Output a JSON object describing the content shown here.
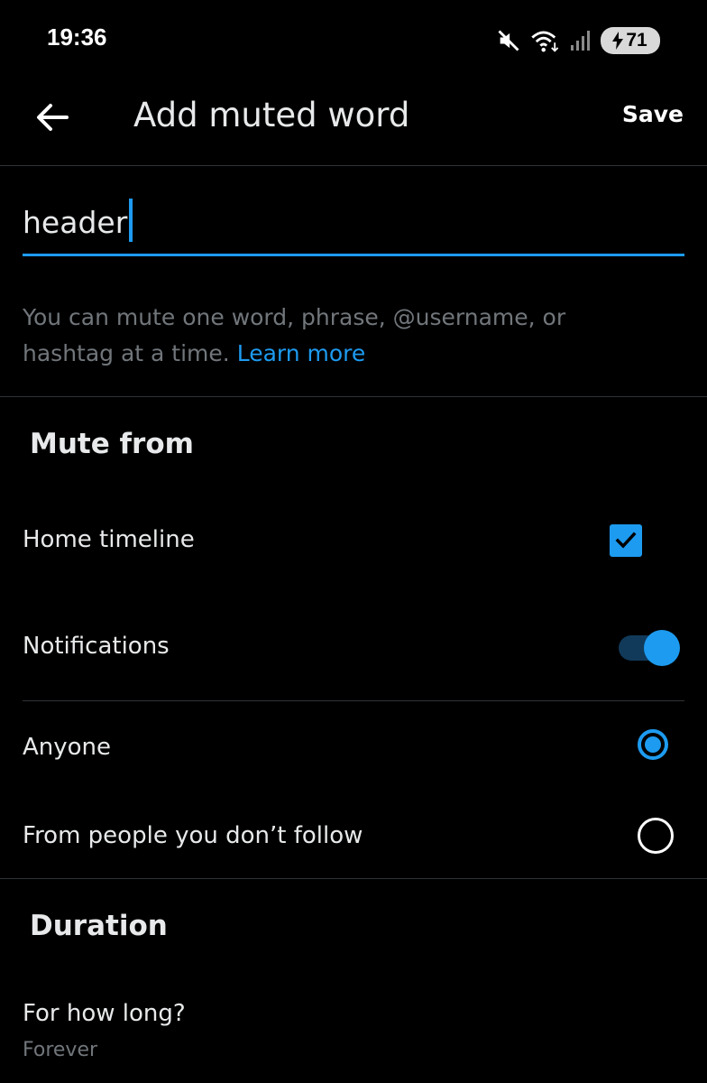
{
  "status_bar": {
    "time": "19:36",
    "battery": "71",
    "icons": [
      "mute-icon",
      "wifi-icon",
      "signal-icon",
      "charging-bolt-icon"
    ]
  },
  "header": {
    "title": "Add muted word",
    "save_label": "Save",
    "back_icon": "arrow-left-icon"
  },
  "input": {
    "value": "header"
  },
  "hint": {
    "text": "You can mute one word, phrase, @username, or hashtag at a time.",
    "link": "Learn more"
  },
  "mute_from": {
    "title": "Mute from",
    "home_timeline": {
      "label": "Home timeline",
      "checked": true
    },
    "notifications": {
      "label": "Notifications",
      "enabled": true
    }
  },
  "audience": {
    "anyone": {
      "label": "Anyone",
      "selected": true
    },
    "not_following": {
      "label": "From people you don’t follow",
      "selected": false
    }
  },
  "duration": {
    "title": "Duration",
    "question": "For how long?",
    "value": "Forever"
  },
  "colors": {
    "accent": "#1d9bf0",
    "background": "#000000",
    "muted_text": "#71767b",
    "divider": "#2f3336"
  }
}
